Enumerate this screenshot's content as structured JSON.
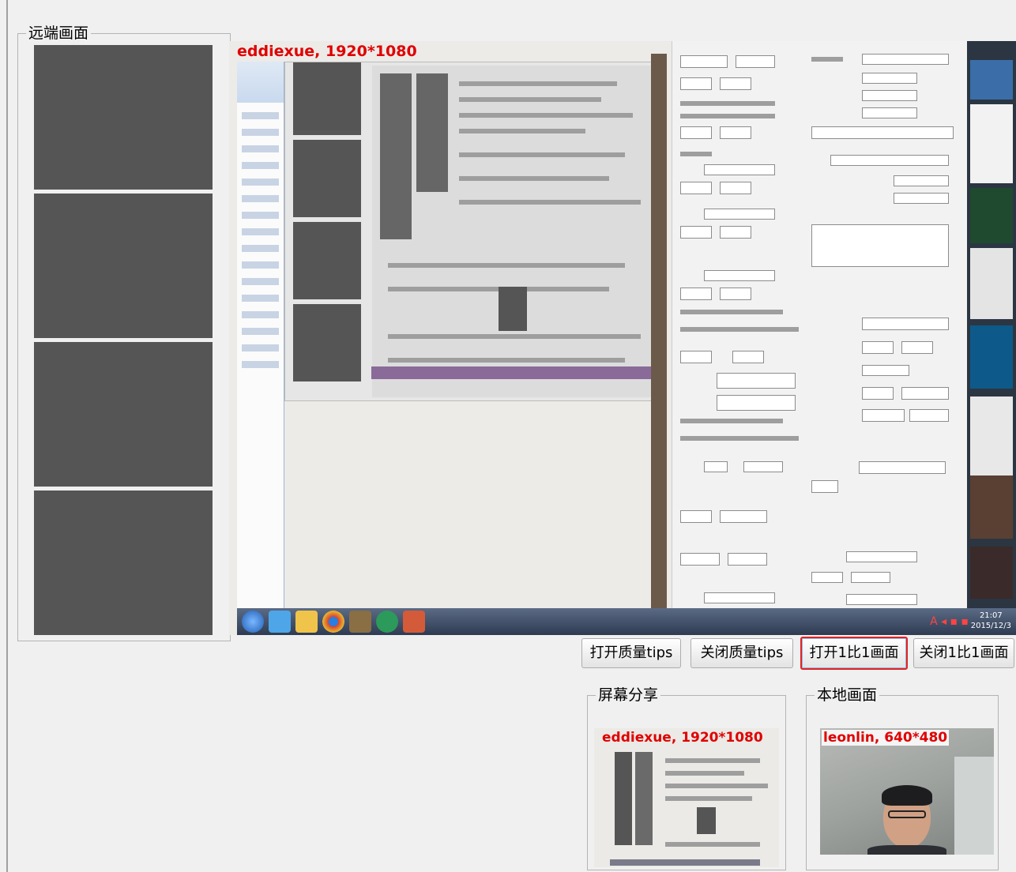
{
  "remote_group": {
    "title": "远端画面"
  },
  "main_view": {
    "overlay_label": "eddiexue, 1920*1080",
    "taskbar_time": "21:07",
    "taskbar_date": "2015/12/3"
  },
  "buttons": {
    "open_quality_tips": "打开质量tips",
    "close_quality_tips": "关闭质量tips",
    "open_1to1": "打开1比1画面",
    "close_1to1": "关闭1比1画面"
  },
  "screen_share": {
    "title": "屏幕分享",
    "overlay_label": "eddiexue, 1920*1080"
  },
  "local_view": {
    "title": "本地画面",
    "overlay_label": "leonlin, 640*480"
  },
  "colors": {
    "overlay_text": "#e00000",
    "placeholder_slot": "#555555",
    "active_button_border": "#e22222"
  }
}
